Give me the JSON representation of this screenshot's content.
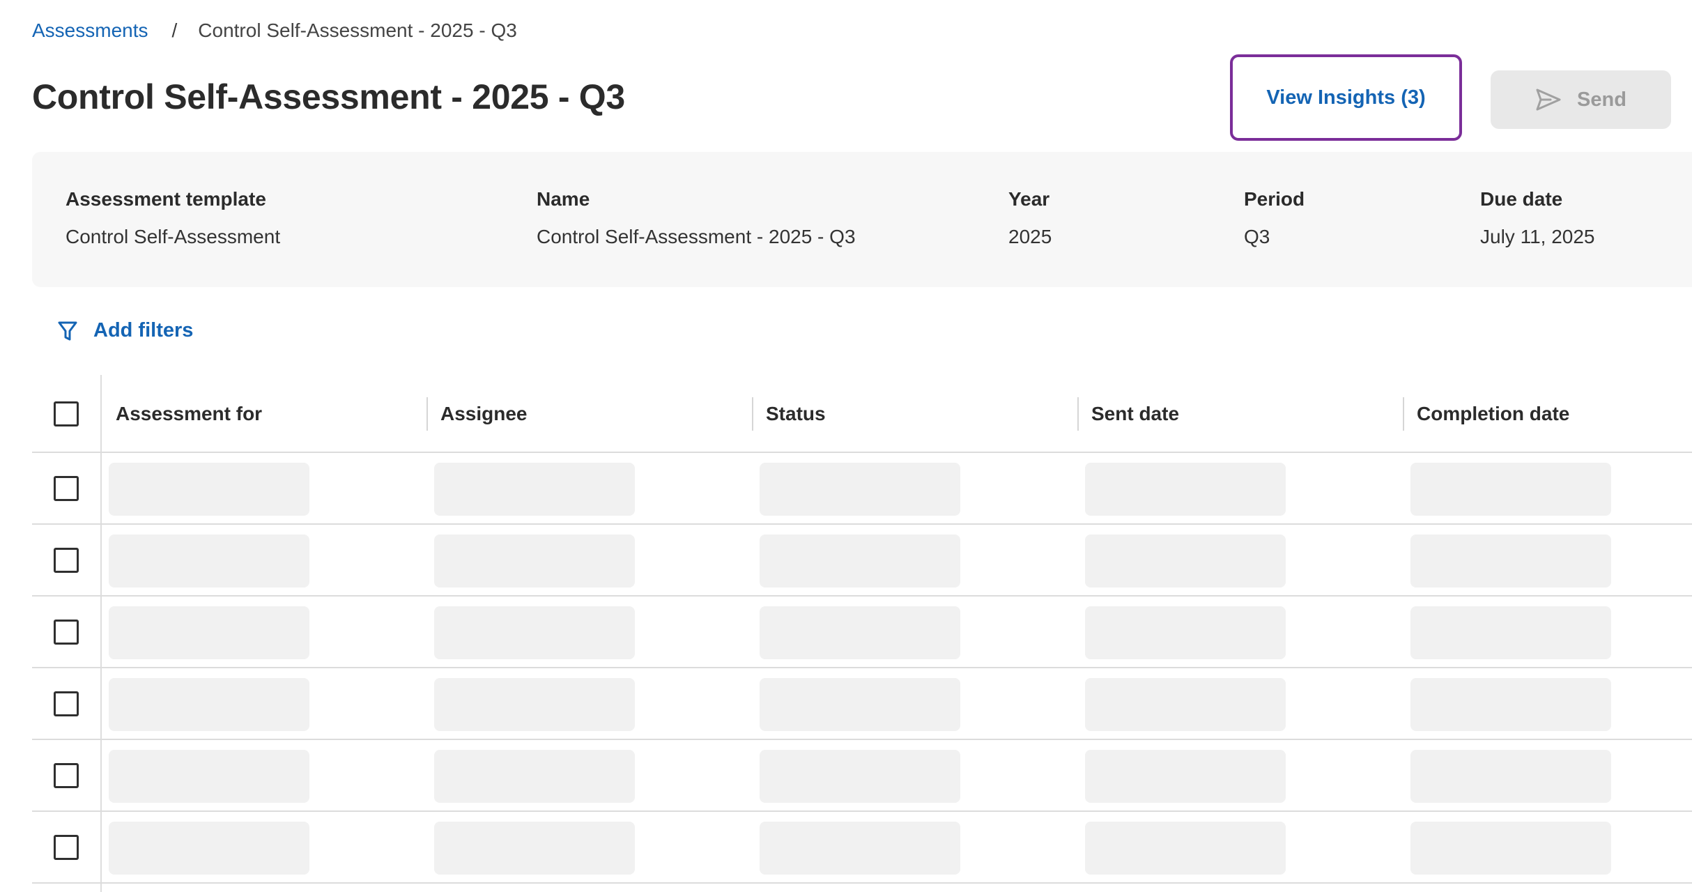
{
  "breadcrumb": {
    "parent": "Assessments",
    "separator": "/",
    "current": "Control Self-Assessment - 2025 - Q3"
  },
  "page_title": "Control Self-Assessment - 2025 - Q3",
  "actions": {
    "insights_label": "View Insights (3)",
    "send_label": "Send",
    "send_disabled": true,
    "focus_ring_color": "#7b2e99"
  },
  "summary": {
    "fields": [
      {
        "label": "Assessment template",
        "value": "Control Self-Assessment"
      },
      {
        "label": "Name",
        "value": "Control Self-Assessment - 2025 - Q3"
      },
      {
        "label": "Year",
        "value": "2025"
      },
      {
        "label": "Period",
        "value": "Q3"
      },
      {
        "label": "Due date",
        "value": "July 11, 2025"
      }
    ]
  },
  "filters": {
    "label": "Add filters",
    "icon": "filter-icon"
  },
  "table": {
    "columns": [
      "Assessment for",
      "Assignee",
      "Status",
      "Sent date",
      "Completion date"
    ],
    "loading_rows": 6,
    "state": "loading"
  },
  "colors": {
    "link": "#1464b4",
    "text": "#2b2b2b",
    "panel_bg": "#f7f7f7",
    "skeleton": "#f1f1f1",
    "disabled_bg": "#e8e8e8",
    "disabled_text": "#9a9a9a"
  }
}
